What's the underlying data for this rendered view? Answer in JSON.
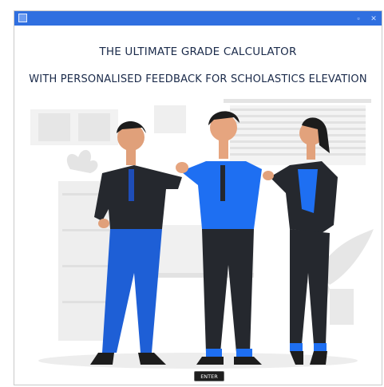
{
  "window": {
    "title_bar_color": "#2f6fe0",
    "controls": [
      "minimize-icon",
      "close-icon"
    ]
  },
  "header": {
    "title_line1": "THE ULTIMATE GRADE CALCULATOR",
    "title_line2": "WITH PERSONALISED FEEDBACK FOR SCHOLASTICS ELEVATION"
  },
  "illustration": {
    "subject": "three people in office attire celebrating",
    "colors": {
      "accent_blue": "#1e6ff2",
      "dark": "#25282e",
      "skin": "#e6a57f",
      "background_gray": "#ebebeb"
    }
  },
  "actions": {
    "enter_label": "ENTER"
  }
}
